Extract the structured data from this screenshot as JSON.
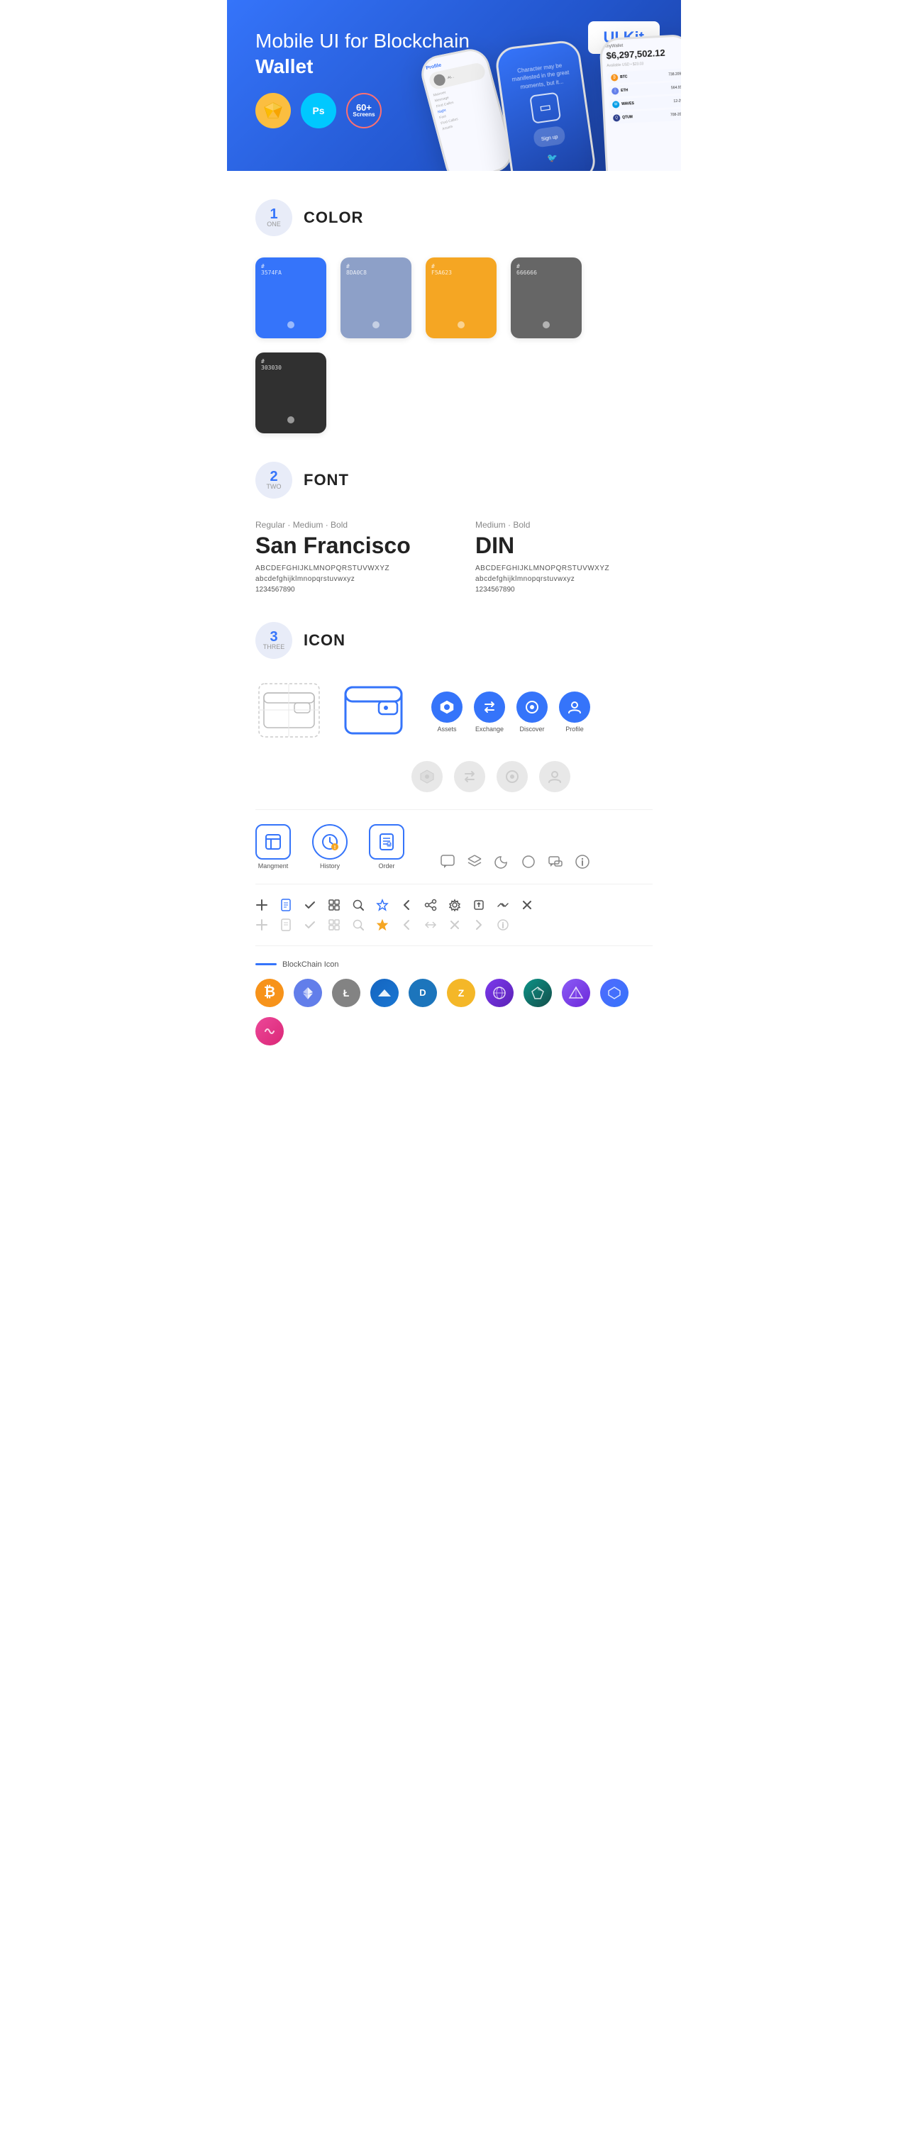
{
  "hero": {
    "title": "Mobile UI for Blockchain ",
    "title_bold": "Wallet",
    "badge": "UI Kit",
    "sketch_label": "Sk",
    "ps_label": "Ps",
    "screens_label": "60+\nScreens"
  },
  "sections": {
    "color": {
      "number": "1",
      "number_word": "ONE",
      "title": "COLOR",
      "swatches": [
        {
          "hex": "#3574FA",
          "label": "#\n3574FA"
        },
        {
          "hex": "#8DA0C8",
          "label": "#\n8DA0C8"
        },
        {
          "hex": "#F5A623",
          "label": "#\nF5A623"
        },
        {
          "hex": "#666666",
          "label": "#\n666666"
        },
        {
          "hex": "#303030",
          "label": "#\n303030"
        }
      ]
    },
    "font": {
      "number": "2",
      "number_word": "TWO",
      "title": "FONT",
      "fonts": [
        {
          "style_label": "Regular · Medium · Bold",
          "name": "San Francisco",
          "uppercase": "ABCDEFGHIJKLMNOPQRSTUVWXYZ",
          "lowercase": "abcdefghijklmnopqrstuvwxyz",
          "numbers": "1234567890"
        },
        {
          "style_label": "Medium · Bold",
          "name": "DIN",
          "uppercase": "ABCDEFGHIJKLMNOPQRSTUVWXYZ",
          "lowercase": "abcdefghijklmnopqrstuvwxyz",
          "numbers": "1234567890"
        }
      ]
    },
    "icon": {
      "number": "3",
      "number_word": "THREE",
      "title": "ICON",
      "nav_icons": [
        {
          "symbol": "◆",
          "label": "Assets"
        },
        {
          "symbol": "↕",
          "label": "Exchange"
        },
        {
          "symbol": "⊕",
          "label": "Discover"
        },
        {
          "symbol": "👤",
          "label": "Profile"
        }
      ],
      "app_icons": [
        {
          "symbol": "▭",
          "label": "Mangment"
        },
        {
          "symbol": "⏱",
          "label": "History"
        },
        {
          "symbol": "📋",
          "label": "Order"
        }
      ],
      "misc_icons_1": [
        "💬",
        "≡",
        "☽",
        "●",
        "💬",
        "ℹ"
      ],
      "misc_icons_2": [
        "+",
        "📋",
        "✓",
        "⊞",
        "🔍",
        "☆",
        "‹",
        "⟨",
        "⚙",
        "⬡",
        "⇄",
        "✕"
      ],
      "blockchain_label": "BlockChain Icon",
      "coins": [
        {
          "symbol": "₿",
          "color": "#F7931A",
          "label": "BTC"
        },
        {
          "symbol": "Ξ",
          "color": "#627EEA",
          "label": "ETH"
        },
        {
          "symbol": "Ł",
          "color": "#838383",
          "label": "LTC"
        },
        {
          "symbol": "W",
          "color": "#009CE6",
          "label": "WAVES"
        },
        {
          "symbol": "D",
          "color": "#1c75bc",
          "label": "DASH"
        },
        {
          "symbol": "Z",
          "color": "#F4B728",
          "label": "ZEC"
        },
        {
          "symbol": "◎",
          "color": "#8B5CF6",
          "label": ""
        },
        {
          "symbol": "◈",
          "color": "#0d9488",
          "label": ""
        },
        {
          "symbol": "P",
          "color": "#8247e5",
          "label": ""
        },
        {
          "symbol": "B",
          "color": "#516aff",
          "label": ""
        },
        {
          "symbol": "~",
          "color": "#ec4899",
          "label": ""
        }
      ]
    }
  }
}
